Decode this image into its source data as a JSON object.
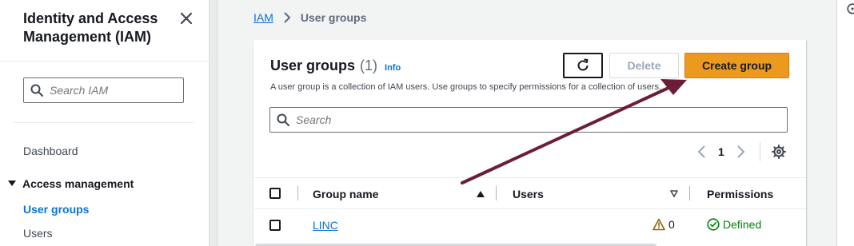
{
  "sidebar": {
    "title": "Identity and Access Management (IAM)",
    "search_placeholder": "Search IAM",
    "dashboard_label": "Dashboard",
    "section_label": "Access management",
    "items": [
      {
        "label": "User groups",
        "active": true
      },
      {
        "label": "Users",
        "active": false
      }
    ]
  },
  "breadcrumb": {
    "root": "IAM",
    "current": "User groups"
  },
  "panel": {
    "title": "User groups",
    "count": "(1)",
    "info_label": "Info",
    "description": "A user group is a collection of IAM users. Use groups to specify permissions for a collection of users.",
    "delete_label": "Delete",
    "create_label": "Create group",
    "search_placeholder": "Search",
    "page_number": "1"
  },
  "table": {
    "columns": [
      "Group name",
      "Users",
      "Permissions"
    ],
    "rows": [
      {
        "group_name": "LINC",
        "users": "0",
        "permissions": "Defined"
      }
    ]
  },
  "colors": {
    "accent": "#0972d3",
    "primary_button": "#ec9a1d",
    "success": "#037f0c",
    "warning": "#8d6605",
    "annotation_arrow": "#6b1f36"
  },
  "icons": [
    "close-icon",
    "search-icon",
    "caret-down-icon",
    "chevron-right-icon",
    "refresh-icon",
    "chevron-left-icon",
    "gear-icon",
    "sort-up-icon",
    "sort-down-icon",
    "warning-icon",
    "check-circle-icon",
    "help-icon"
  ]
}
